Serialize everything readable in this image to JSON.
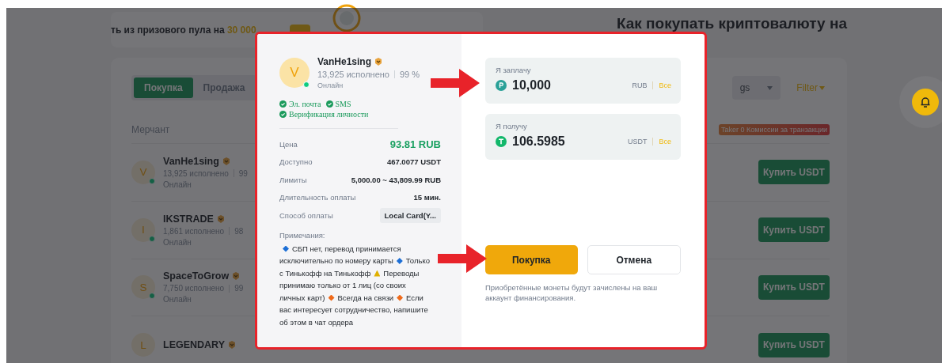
{
  "page": {
    "banner": {
      "text": "ть из призового пула на ",
      "amount": "30 000"
    },
    "heading": "Как покупать криптовалюту на",
    "tabs": [
      {
        "label": "Покупка",
        "selected": true
      },
      {
        "label": "Продажа",
        "selected": false
      }
    ],
    "filter_select": "gs",
    "filter_link": "Filter",
    "merchant_header": "Мерчант",
    "fee_badge": "Taker 0 Комиссии за транзакции",
    "merchants": [
      {
        "initial": "V",
        "name": "VanHe1sing",
        "orders": "13,925 исполнено",
        "rate": "99",
        "status": "Онлайн",
        "online": true,
        "action": "Купить USDT"
      },
      {
        "initial": "I",
        "name": "IKSTRADE",
        "orders": "1,861 исполнено",
        "rate": "98",
        "status": "Онлайн",
        "online": true,
        "action": "Купить USDT"
      },
      {
        "initial": "S",
        "name": "SpaceToGrow",
        "orders": "7,750 исполнено",
        "rate": "99",
        "status": "Онлайн",
        "online": true,
        "action": "Купить USDT"
      },
      {
        "initial": "L",
        "name": "LEGENDARY",
        "action": "Купить USDT"
      }
    ]
  },
  "dialog": {
    "merchant": {
      "initial": "V",
      "name": "VanHe1sing",
      "orders": "13,925 исполнено",
      "rate": "99 %",
      "status": "Онлайн",
      "online": true
    },
    "verifications": [
      "Эл. почта",
      "SMS",
      "Верификация личности"
    ],
    "details": [
      {
        "label": "Цена",
        "value": "93.81 RUB",
        "kind": "price"
      },
      {
        "label": "Доступно",
        "value": "467.0077 USDT",
        "kind": "text"
      },
      {
        "label": "Лимиты",
        "value": "5,000.00 ~ 43,809.99 RUB",
        "kind": "text"
      },
      {
        "label": "Длительность оплаты",
        "value": "15 мин.",
        "kind": "text"
      },
      {
        "label": "Способ оплаты",
        "value": "Local Card(Y...",
        "kind": "tag"
      }
    ],
    "notes_label": "Примечания:",
    "notes": [
      {
        "kind": "diamond",
        "color": "#1d6fd6",
        "text": "СБП нет, перевод принимается исключительно по номеру карты"
      },
      {
        "kind": "diamond",
        "color": "#1d6fd6",
        "text": "Только с Тинькофф на Тинькофф"
      },
      {
        "kind": "warning",
        "color": "#e0b000",
        "text": "Переводы принимаю только от 1 лиц (со своих личных карт)"
      },
      {
        "kind": "diamond",
        "color": "#ef6a1a",
        "text": "Всегда на связи"
      },
      {
        "kind": "diamond",
        "color": "#ef6a1a",
        "text": "Если вас интересует сотрудничество, напишите об этом в чат ордера"
      }
    ],
    "fields": [
      {
        "label": "Я заплачу",
        "value": "10,000",
        "currency": "RUB",
        "action": "Все",
        "kind": "rub"
      },
      {
        "label": "Я получу",
        "value": "106.5985",
        "currency": "USDT",
        "action": "Все",
        "kind": "usdt"
      }
    ],
    "buttons": [
      {
        "label": "Покупка",
        "kind": "primary"
      },
      {
        "label": "Отмена",
        "kind": "secondary"
      }
    ],
    "disclaimer": "Приобретённые монеты будут зачислены на ваш аккаунт финансирования."
  }
}
